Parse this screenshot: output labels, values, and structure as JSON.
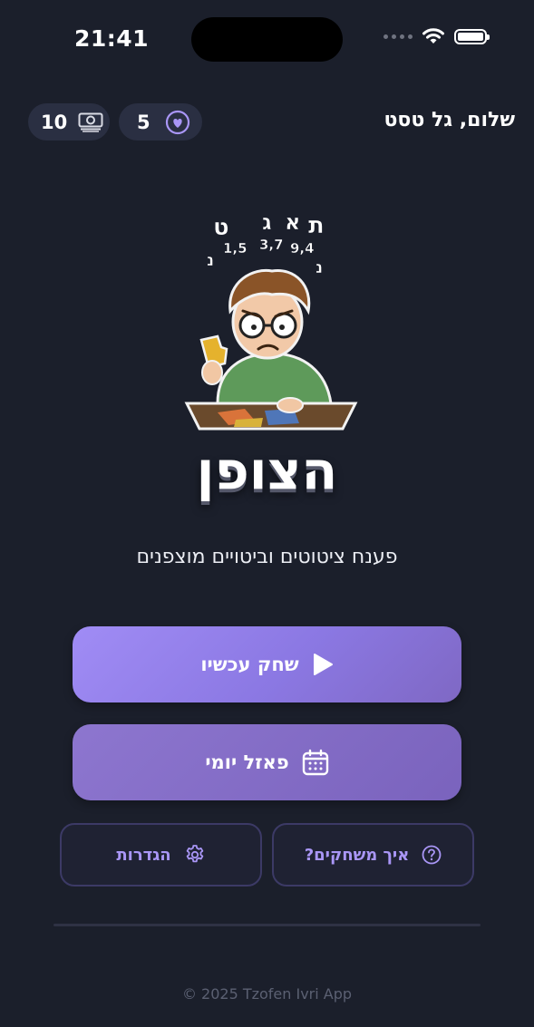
{
  "status_bar": {
    "time": "21:41"
  },
  "header": {
    "greeting": "שלום, גל טסט",
    "coins": "10",
    "hearts": "5"
  },
  "hero": {
    "floating_letters": [
      "ת",
      "א",
      "ג",
      "ט",
      "1,5",
      "3,7",
      "9,4",
      "נ",
      "נ"
    ],
    "app_title": "הצופן",
    "tagline": "פענח ציטוטים וביטויים מוצפנים"
  },
  "buttons": {
    "play_label": "שחק עכשיו",
    "daily_label": "פאזל יומי",
    "howto_label": "איך משחקים?",
    "settings_label": "הגדרות"
  },
  "footer": {
    "copyright": "© 2025 Tzofen Ivri App"
  },
  "colors": {
    "background": "#1b1f2b",
    "accent": "#a996f6",
    "play_button": "#9280ea",
    "daily_button": "#7f68c4",
    "pill": "#2a2f42"
  },
  "icons": {
    "coins": "money-icon",
    "hearts": "heart-icon",
    "play": "play-icon",
    "daily": "calendar-icon",
    "howto": "question-icon",
    "settings": "gear-icon"
  }
}
